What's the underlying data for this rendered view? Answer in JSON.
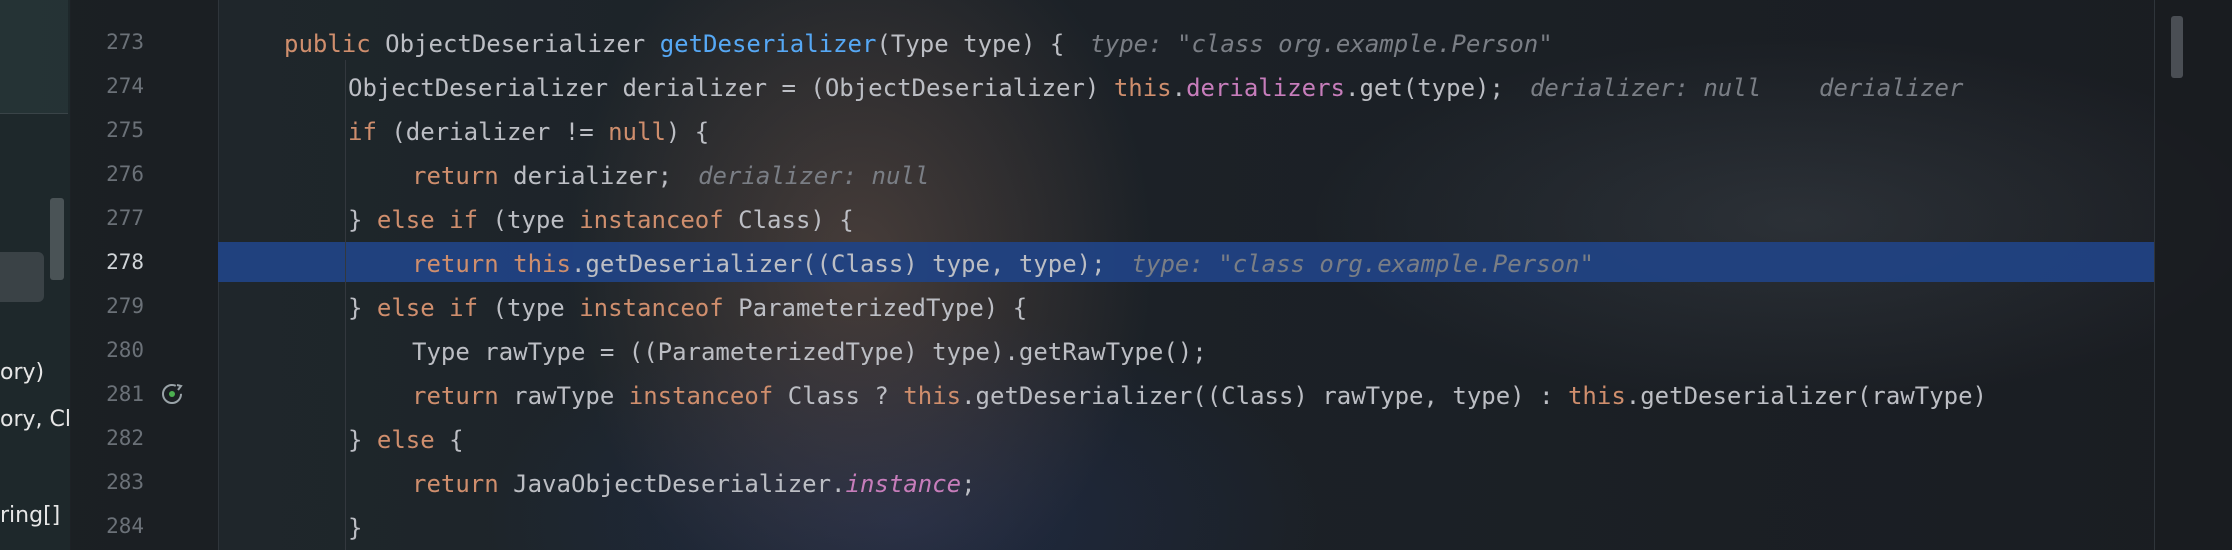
{
  "left_panel": {
    "items": [
      "ory)",
      "ory, Cl",
      "ring[]"
    ]
  },
  "gutter": {
    "line_numbers": [
      "273",
      "274",
      "275",
      "276",
      "277",
      "278",
      "279",
      "280",
      "281",
      "282",
      "283",
      "284"
    ],
    "current_line": "278"
  },
  "code": {
    "lines": [
      {
        "tokens": [
          {
            "t": "public ",
            "c": "kw"
          },
          {
            "t": "ObjectDeserializer ",
            "c": "plain"
          },
          {
            "t": "getDeserializer",
            "c": "fn"
          },
          {
            "t": "(Type type) {",
            "c": "plain"
          }
        ],
        "hint": "type: \"class org.example.Person\""
      },
      {
        "tokens": [
          {
            "t": "ObjectDeserializer derializer = (ObjectDeserializer) ",
            "c": "plain"
          },
          {
            "t": "this",
            "c": "kw"
          },
          {
            "t": ".",
            "c": "plain"
          },
          {
            "t": "derializers",
            "c": "field"
          },
          {
            "t": ".get(type);",
            "c": "plain"
          }
        ],
        "hint": "derializer: null    derializer"
      },
      {
        "tokens": [
          {
            "t": "if ",
            "c": "kw"
          },
          {
            "t": "(derializer != ",
            "c": "plain"
          },
          {
            "t": "null",
            "c": "kw"
          },
          {
            "t": ") {",
            "c": "plain"
          }
        ],
        "hint": ""
      },
      {
        "tokens": [
          {
            "t": "return ",
            "c": "kw"
          },
          {
            "t": "derializer;",
            "c": "plain"
          }
        ],
        "hint": "derializer: null"
      },
      {
        "tokens": [
          {
            "t": "} ",
            "c": "plain"
          },
          {
            "t": "else if ",
            "c": "kw"
          },
          {
            "t": "(type ",
            "c": "plain"
          },
          {
            "t": "instanceof ",
            "c": "kw"
          },
          {
            "t": "Class) {",
            "c": "plain"
          }
        ],
        "hint": ""
      },
      {
        "tokens": [
          {
            "t": "return ",
            "c": "kw"
          },
          {
            "t": "this",
            "c": "kw"
          },
          {
            "t": ".getDeserializer((Class) type, type);",
            "c": "plain"
          }
        ],
        "hint": "type: \"class org.example.Person\""
      },
      {
        "tokens": [
          {
            "t": "} ",
            "c": "plain"
          },
          {
            "t": "else if ",
            "c": "kw"
          },
          {
            "t": "(type ",
            "c": "plain"
          },
          {
            "t": "instanceof ",
            "c": "kw"
          },
          {
            "t": "ParameterizedType) {",
            "c": "plain"
          }
        ],
        "hint": ""
      },
      {
        "tokens": [
          {
            "t": "Type rawType = ((ParameterizedType) type).getRawType();",
            "c": "plain"
          }
        ],
        "hint": ""
      },
      {
        "tokens": [
          {
            "t": "return ",
            "c": "kw"
          },
          {
            "t": "rawType ",
            "c": "plain"
          },
          {
            "t": "instanceof ",
            "c": "kw"
          },
          {
            "t": "Class ? ",
            "c": "plain"
          },
          {
            "t": "this",
            "c": "kw"
          },
          {
            "t": ".getDeserializer((Class) rawType, type) : ",
            "c": "plain"
          },
          {
            "t": "this",
            "c": "kw"
          },
          {
            "t": ".getDeserializer(rawType)",
            "c": "plain"
          }
        ],
        "hint": ""
      },
      {
        "tokens": [
          {
            "t": "} ",
            "c": "plain"
          },
          {
            "t": "else ",
            "c": "kw"
          },
          {
            "t": "{",
            "c": "plain"
          }
        ],
        "hint": ""
      },
      {
        "tokens": [
          {
            "t": "return ",
            "c": "kw"
          },
          {
            "t": "JavaObjectDeserializer.",
            "c": "plain"
          },
          {
            "t": "instance",
            "c": "static-field"
          },
          {
            "t": ";",
            "c": "plain"
          }
        ],
        "hint": ""
      },
      {
        "tokens": [
          {
            "t": "}",
            "c": "plain"
          }
        ],
        "hint": ""
      }
    ]
  },
  "colors": {
    "keyword": "#cf8e6d",
    "method": "#56a8f5",
    "field": "#c77dbb",
    "hint": "#7a7e85",
    "execution_line": "#214283"
  },
  "icons": {
    "gutter_281": "reload-icon"
  }
}
